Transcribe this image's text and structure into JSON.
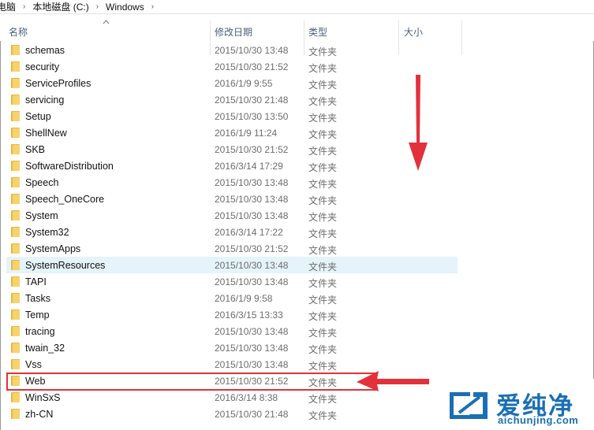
{
  "breadcrumb": {
    "items": [
      "电脑",
      "本地磁盘 (C:)",
      "Windows"
    ],
    "separator": "›"
  },
  "columns": {
    "name": "名称",
    "date": "修改日期",
    "type": "类型",
    "size": "大小"
  },
  "files": [
    {
      "name": "schemas",
      "date": "2015/10/30 13:48",
      "type": "文件夹"
    },
    {
      "name": "security",
      "date": "2015/10/30 21:52",
      "type": "文件夹"
    },
    {
      "name": "ServiceProfiles",
      "date": "2016/1/9 9:55",
      "type": "文件夹"
    },
    {
      "name": "servicing",
      "date": "2015/10/30 21:48",
      "type": "文件夹"
    },
    {
      "name": "Setup",
      "date": "2015/10/30 13:50",
      "type": "文件夹"
    },
    {
      "name": "ShellNew",
      "date": "2016/1/9 11:24",
      "type": "文件夹"
    },
    {
      "name": "SKB",
      "date": "2015/10/30 21:52",
      "type": "文件夹"
    },
    {
      "name": "SoftwareDistribution",
      "date": "2016/3/14 17:29",
      "type": "文件夹"
    },
    {
      "name": "Speech",
      "date": "2015/10/30 13:48",
      "type": "文件夹"
    },
    {
      "name": "Speech_OneCore",
      "date": "2015/10/30 13:48",
      "type": "文件夹"
    },
    {
      "name": "System",
      "date": "2015/10/30 13:48",
      "type": "文件夹"
    },
    {
      "name": "System32",
      "date": "2016/3/14 17:22",
      "type": "文件夹"
    },
    {
      "name": "SystemApps",
      "date": "2015/10/30 21:52",
      "type": "文件夹"
    },
    {
      "name": "SystemResources",
      "date": "2015/10/30 13:48",
      "type": "文件夹"
    },
    {
      "name": "TAPI",
      "date": "2015/10/30 13:48",
      "type": "文件夹"
    },
    {
      "name": "Tasks",
      "date": "2016/1/9 9:58",
      "type": "文件夹"
    },
    {
      "name": "Temp",
      "date": "2016/3/15 13:33",
      "type": "文件夹"
    },
    {
      "name": "tracing",
      "date": "2015/10/30 13:48",
      "type": "文件夹"
    },
    {
      "name": "twain_32",
      "date": "2015/10/30 13:48",
      "type": "文件夹"
    },
    {
      "name": "Vss",
      "date": "2015/10/30 13:48",
      "type": "文件夹"
    },
    {
      "name": "Web",
      "date": "2015/10/30 21:52",
      "type": "文件夹"
    },
    {
      "name": "WinSxS",
      "date": "2016/3/14 8:38",
      "type": "文件夹"
    },
    {
      "name": "zh-CN",
      "date": "2015/10/30 21:48",
      "type": "文件夹"
    }
  ],
  "hovered_row": "SystemResources",
  "highlighted_row": "Web",
  "watermark": {
    "text": "爱纯净",
    "url": "aichunjing.com"
  },
  "colors": {
    "annotation_red": "#e2313b",
    "hover_blue": "#e5f3fb",
    "folder_yellow": "#f7d36a",
    "brand_blue": "#1a6fb4"
  },
  "icons": {
    "folder": "folder-icon",
    "breadcrumb_separator": "chevron-right-icon",
    "sort": "sort-up-caret-icon"
  }
}
